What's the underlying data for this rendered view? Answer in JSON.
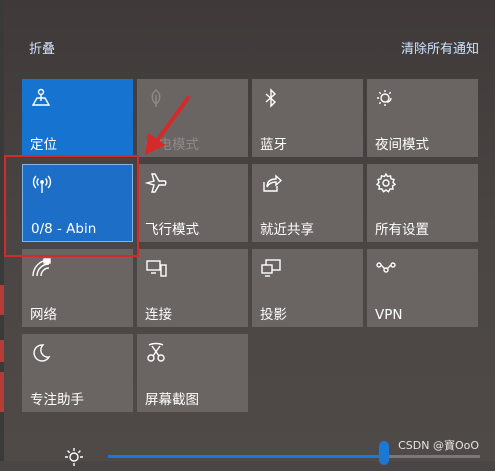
{
  "header": {
    "collapse_label": "折叠",
    "clear_all_label": "清除所有通知"
  },
  "tiles": [
    {
      "label": "定位",
      "icon": "location-icon",
      "state": "on"
    },
    {
      "label": "省电模式",
      "icon": "battery-saver-icon",
      "state": "disabled"
    },
    {
      "label": "蓝牙",
      "icon": "bluetooth-icon",
      "state": "off"
    },
    {
      "label": "夜间模式",
      "icon": "night-light-icon",
      "state": "off"
    },
    {
      "label": "0/8 - Abin",
      "icon": "hotspot-icon",
      "state": "on"
    },
    {
      "label": "飞行模式",
      "icon": "airplane-icon",
      "state": "off"
    },
    {
      "label": "就近共享",
      "icon": "nearby-share-icon",
      "state": "off"
    },
    {
      "label": "所有设置",
      "icon": "settings-icon",
      "state": "off"
    },
    {
      "label": "网络",
      "icon": "network-icon",
      "state": "off"
    },
    {
      "label": "连接",
      "icon": "connect-icon",
      "state": "off"
    },
    {
      "label": "投影",
      "icon": "project-icon",
      "state": "off"
    },
    {
      "label": "VPN",
      "icon": "vpn-icon",
      "state": "off"
    },
    {
      "label": "专注助手",
      "icon": "focus-assist-icon",
      "state": "off"
    },
    {
      "label": "屏幕截图",
      "icon": "screen-snip-icon",
      "state": "off"
    }
  ],
  "brightness": {
    "icon": "brightness-icon",
    "level": 0.75
  },
  "watermark": "CSDN @寶OoO",
  "colors": {
    "accent": "#1674d0",
    "highlight": "#d42a2a"
  }
}
